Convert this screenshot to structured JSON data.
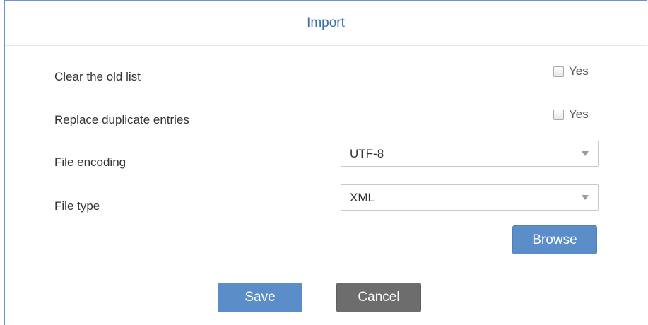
{
  "dialog": {
    "title": "Import"
  },
  "options": {
    "clear_old_list": {
      "label": "Clear the old list",
      "checkbox_label": "Yes",
      "checked": false
    },
    "replace_duplicates": {
      "label": "Replace duplicate entries",
      "checkbox_label": "Yes",
      "checked": false
    },
    "file_encoding": {
      "label": "File encoding",
      "selected": "UTF-8"
    },
    "file_type": {
      "label": "File type",
      "selected": "XML"
    }
  },
  "buttons": {
    "browse": "Browse",
    "save": "Save",
    "cancel": "Cancel"
  },
  "colors": {
    "title": "#3a6ea5",
    "primary_button": "#5b8ec8",
    "secondary_button": "#6d6d6d",
    "border_accent": "#6b93cf"
  },
  "icons": {
    "select_arrow": "triangle-down"
  }
}
